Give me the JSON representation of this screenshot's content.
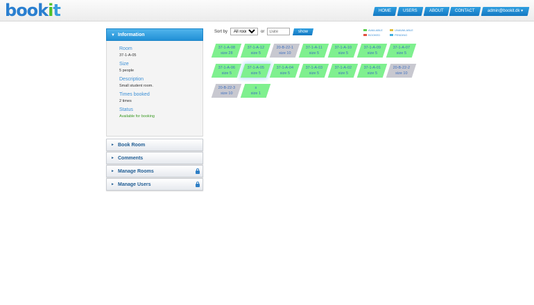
{
  "logo": {
    "b1": "b",
    "o1": "oo",
    "k": "k",
    "i": "i",
    "t": "t"
  },
  "nav": {
    "home": "HOME",
    "users": "USERS",
    "about": "ABOUT",
    "contact": "CONTACT",
    "user": "admin@bookit.dk ▾"
  },
  "sidebar": {
    "information_title": "Information",
    "room_label": "Room",
    "room_value": "37-1-A-05",
    "size_label": "Size",
    "size_value": "5 people",
    "description_label": "Description",
    "description_value": "Small student room.",
    "times_label": "Times booked",
    "times_value": "2 times",
    "status_label": "Status",
    "status_value": "Available for booking",
    "book_room": "Book Room",
    "comments": "Comments",
    "manage_rooms": "Manage Rooms",
    "manage_users": "Manage Users"
  },
  "sort": {
    "label": "Sort by",
    "selected": "All rooms",
    "or": "or",
    "date_placeholder": "Date",
    "show": "show"
  },
  "legend": {
    "available": "Available",
    "unavailable": "Unavailable",
    "booked": "Booked",
    "pending": "Pending",
    "colors": {
      "available": "#5ccf4e",
      "unavailable": "#e0c040",
      "booked": "#e05040",
      "pending": "#40b0e0"
    }
  },
  "rooms": [
    {
      "name": "37-1-A-08",
      "size": "size 28",
      "status": "available"
    },
    {
      "name": "37-1-A-12",
      "size": "size 5",
      "status": "available"
    },
    {
      "name": "20-B-22-1",
      "size": "size 10",
      "status": "unavailable"
    },
    {
      "name": "37-1-A-11",
      "size": "size 5",
      "status": "available"
    },
    {
      "name": "37-1-A-10",
      "size": "size 5",
      "status": "available"
    },
    {
      "name": "37-1-A-09",
      "size": "size 5",
      "status": "available"
    },
    {
      "name": "37-1-A-07",
      "size": "size 5",
      "status": "available"
    },
    {
      "name": "37-1-A-06",
      "size": "size 5",
      "status": "available"
    },
    {
      "name": "37-1-A-05",
      "size": "size 5",
      "status": "available",
      "selected": true
    },
    {
      "name": "37-1-A-04",
      "size": "size 5",
      "status": "available"
    },
    {
      "name": "37-1-A-03",
      "size": "size 5",
      "status": "available"
    },
    {
      "name": "37-1-A-02",
      "size": "size 5",
      "status": "available"
    },
    {
      "name": "37-1-A-01",
      "size": "size 5",
      "status": "available"
    },
    {
      "name": "20-B-22-2",
      "size": "size 10",
      "status": "unavailable"
    },
    {
      "name": "20-B-22-3",
      "size": "size 10",
      "status": "unavailable"
    },
    {
      "name": "s",
      "size": "size 1",
      "status": "available"
    }
  ]
}
